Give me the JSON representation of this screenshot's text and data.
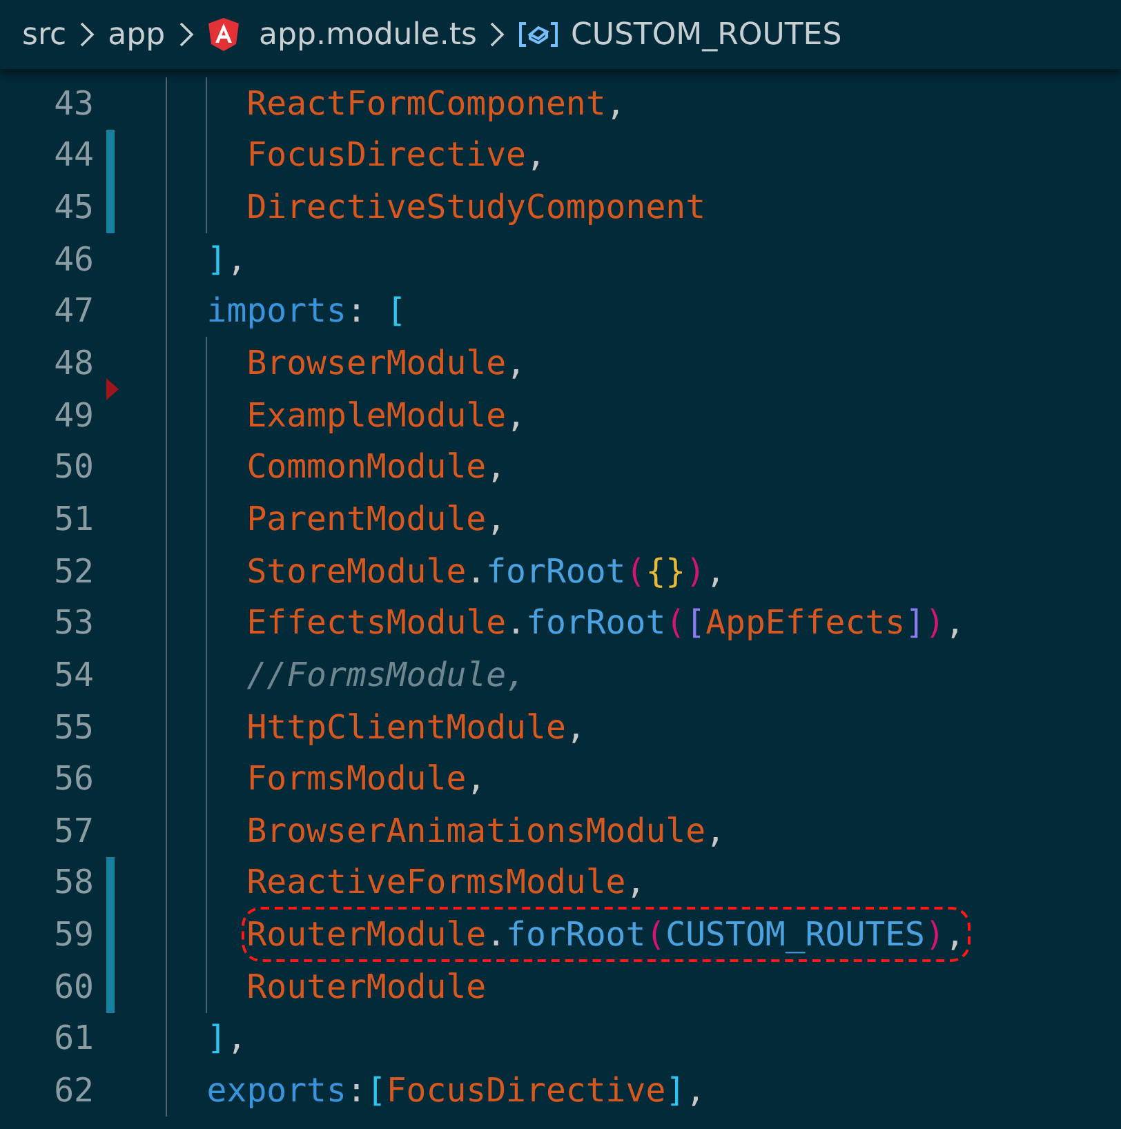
{
  "breadcrumb": {
    "items": [
      {
        "kind": "folder",
        "label": "src"
      },
      {
        "kind": "folder",
        "label": "app"
      },
      {
        "kind": "angular-file",
        "label": "app.module.ts"
      },
      {
        "kind": "symbol",
        "label": "CUSTOM_ROUTES"
      }
    ]
  },
  "editor": {
    "lines": [
      {
        "number": "43",
        "modified": false,
        "deleted_above": false,
        "highlighted": false,
        "tokens": [
          {
            "kind": "identifier",
            "text": "      ReactFormComponent"
          },
          {
            "kind": "punctuation",
            "text": ","
          }
        ]
      },
      {
        "number": "44",
        "modified": true,
        "deleted_above": false,
        "highlighted": false,
        "tokens": [
          {
            "kind": "identifier",
            "text": "      FocusDirective"
          },
          {
            "kind": "punctuation",
            "text": ","
          }
        ]
      },
      {
        "number": "45",
        "modified": true,
        "deleted_above": false,
        "highlighted": false,
        "tokens": [
          {
            "kind": "identifier",
            "text": "      DirectiveStudyComponent"
          }
        ]
      },
      {
        "number": "46",
        "modified": false,
        "deleted_above": false,
        "highlighted": false,
        "tokens": [
          {
            "kind": "bracket",
            "text": "    ]"
          },
          {
            "kind": "punctuation",
            "text": ","
          }
        ]
      },
      {
        "number": "47",
        "modified": false,
        "deleted_above": false,
        "highlighted": false,
        "tokens": [
          {
            "kind": "property",
            "text": "    imports"
          },
          {
            "kind": "punctuation",
            "text": ": "
          },
          {
            "kind": "bracket",
            "text": "["
          }
        ]
      },
      {
        "number": "48",
        "modified": false,
        "deleted_above": false,
        "highlighted": false,
        "tokens": [
          {
            "kind": "identifier",
            "text": "      BrowserModule"
          },
          {
            "kind": "punctuation",
            "text": ","
          }
        ]
      },
      {
        "number": "49",
        "modified": false,
        "deleted_above": true,
        "highlighted": false,
        "tokens": [
          {
            "kind": "identifier",
            "text": "      ExampleModule"
          },
          {
            "kind": "punctuation",
            "text": ","
          }
        ]
      },
      {
        "number": "50",
        "modified": false,
        "deleted_above": false,
        "highlighted": false,
        "tokens": [
          {
            "kind": "identifier",
            "text": "      CommonModule"
          },
          {
            "kind": "punctuation",
            "text": ","
          }
        ]
      },
      {
        "number": "51",
        "modified": false,
        "deleted_above": false,
        "highlighted": false,
        "tokens": [
          {
            "kind": "identifier",
            "text": "      ParentModule"
          },
          {
            "kind": "punctuation",
            "text": ","
          }
        ]
      },
      {
        "number": "52",
        "modified": false,
        "deleted_above": false,
        "highlighted": false,
        "tokens": [
          {
            "kind": "identifier",
            "text": "      StoreModule"
          },
          {
            "kind": "punctuation",
            "text": "."
          },
          {
            "kind": "method",
            "text": "forRoot"
          },
          {
            "kind": "paren",
            "text": "("
          },
          {
            "kind": "brace",
            "text": "{}"
          },
          {
            "kind": "paren",
            "text": ")"
          },
          {
            "kind": "punctuation",
            "text": ","
          }
        ]
      },
      {
        "number": "53",
        "modified": false,
        "deleted_above": false,
        "highlighted": false,
        "tokens": [
          {
            "kind": "identifier",
            "text": "      EffectsModule"
          },
          {
            "kind": "punctuation",
            "text": "."
          },
          {
            "kind": "method",
            "text": "forRoot"
          },
          {
            "kind": "paren",
            "text": "("
          },
          {
            "kind": "inner-bracket",
            "text": "["
          },
          {
            "kind": "identifier",
            "text": "AppEffects"
          },
          {
            "kind": "inner-bracket",
            "text": "]"
          },
          {
            "kind": "paren",
            "text": ")"
          },
          {
            "kind": "punctuation",
            "text": ","
          }
        ]
      },
      {
        "number": "54",
        "modified": false,
        "deleted_above": false,
        "highlighted": false,
        "tokens": [
          {
            "kind": "comment",
            "text": "      //FormsModule,"
          }
        ]
      },
      {
        "number": "55",
        "modified": false,
        "deleted_above": false,
        "highlighted": false,
        "tokens": [
          {
            "kind": "identifier",
            "text": "      HttpClientModule"
          },
          {
            "kind": "punctuation",
            "text": ","
          }
        ]
      },
      {
        "number": "56",
        "modified": false,
        "deleted_above": false,
        "highlighted": false,
        "tokens": [
          {
            "kind": "identifier",
            "text": "      FormsModule"
          },
          {
            "kind": "punctuation",
            "text": ","
          }
        ]
      },
      {
        "number": "57",
        "modified": false,
        "deleted_above": false,
        "highlighted": false,
        "tokens": [
          {
            "kind": "identifier",
            "text": "      BrowserAnimationsModule"
          },
          {
            "kind": "punctuation",
            "text": ","
          }
        ]
      },
      {
        "number": "58",
        "modified": true,
        "deleted_above": false,
        "highlighted": false,
        "tokens": [
          {
            "kind": "identifier",
            "text": "      ReactiveFormsModule"
          },
          {
            "kind": "punctuation",
            "text": ","
          }
        ]
      },
      {
        "number": "59",
        "modified": true,
        "deleted_above": false,
        "highlighted": true,
        "tokens": [
          {
            "kind": "identifier",
            "text": "      RouterModule"
          },
          {
            "kind": "punctuation",
            "text": "."
          },
          {
            "kind": "method",
            "text": "forRoot"
          },
          {
            "kind": "paren",
            "text": "("
          },
          {
            "kind": "constant",
            "text": "CUSTOM_ROUTES"
          },
          {
            "kind": "paren",
            "text": ")"
          },
          {
            "kind": "punctuation",
            "text": ","
          }
        ]
      },
      {
        "number": "60",
        "modified": true,
        "deleted_above": false,
        "highlighted": false,
        "tokens": [
          {
            "kind": "identifier",
            "text": "      RouterModule"
          }
        ]
      },
      {
        "number": "61",
        "modified": false,
        "deleted_above": false,
        "highlighted": false,
        "tokens": [
          {
            "kind": "bracket",
            "text": "    ]"
          },
          {
            "kind": "punctuation",
            "text": ","
          }
        ]
      },
      {
        "number": "62",
        "modified": false,
        "deleted_above": false,
        "highlighted": false,
        "tokens": [
          {
            "kind": "property",
            "text": "    exports"
          },
          {
            "kind": "punctuation",
            "text": ":"
          },
          {
            "kind": "bracket",
            "text": "["
          },
          {
            "kind": "identifier",
            "text": "FocusDirective"
          },
          {
            "kind": "bracket",
            "text": "]"
          },
          {
            "kind": "punctuation",
            "text": ","
          }
        ]
      }
    ]
  }
}
